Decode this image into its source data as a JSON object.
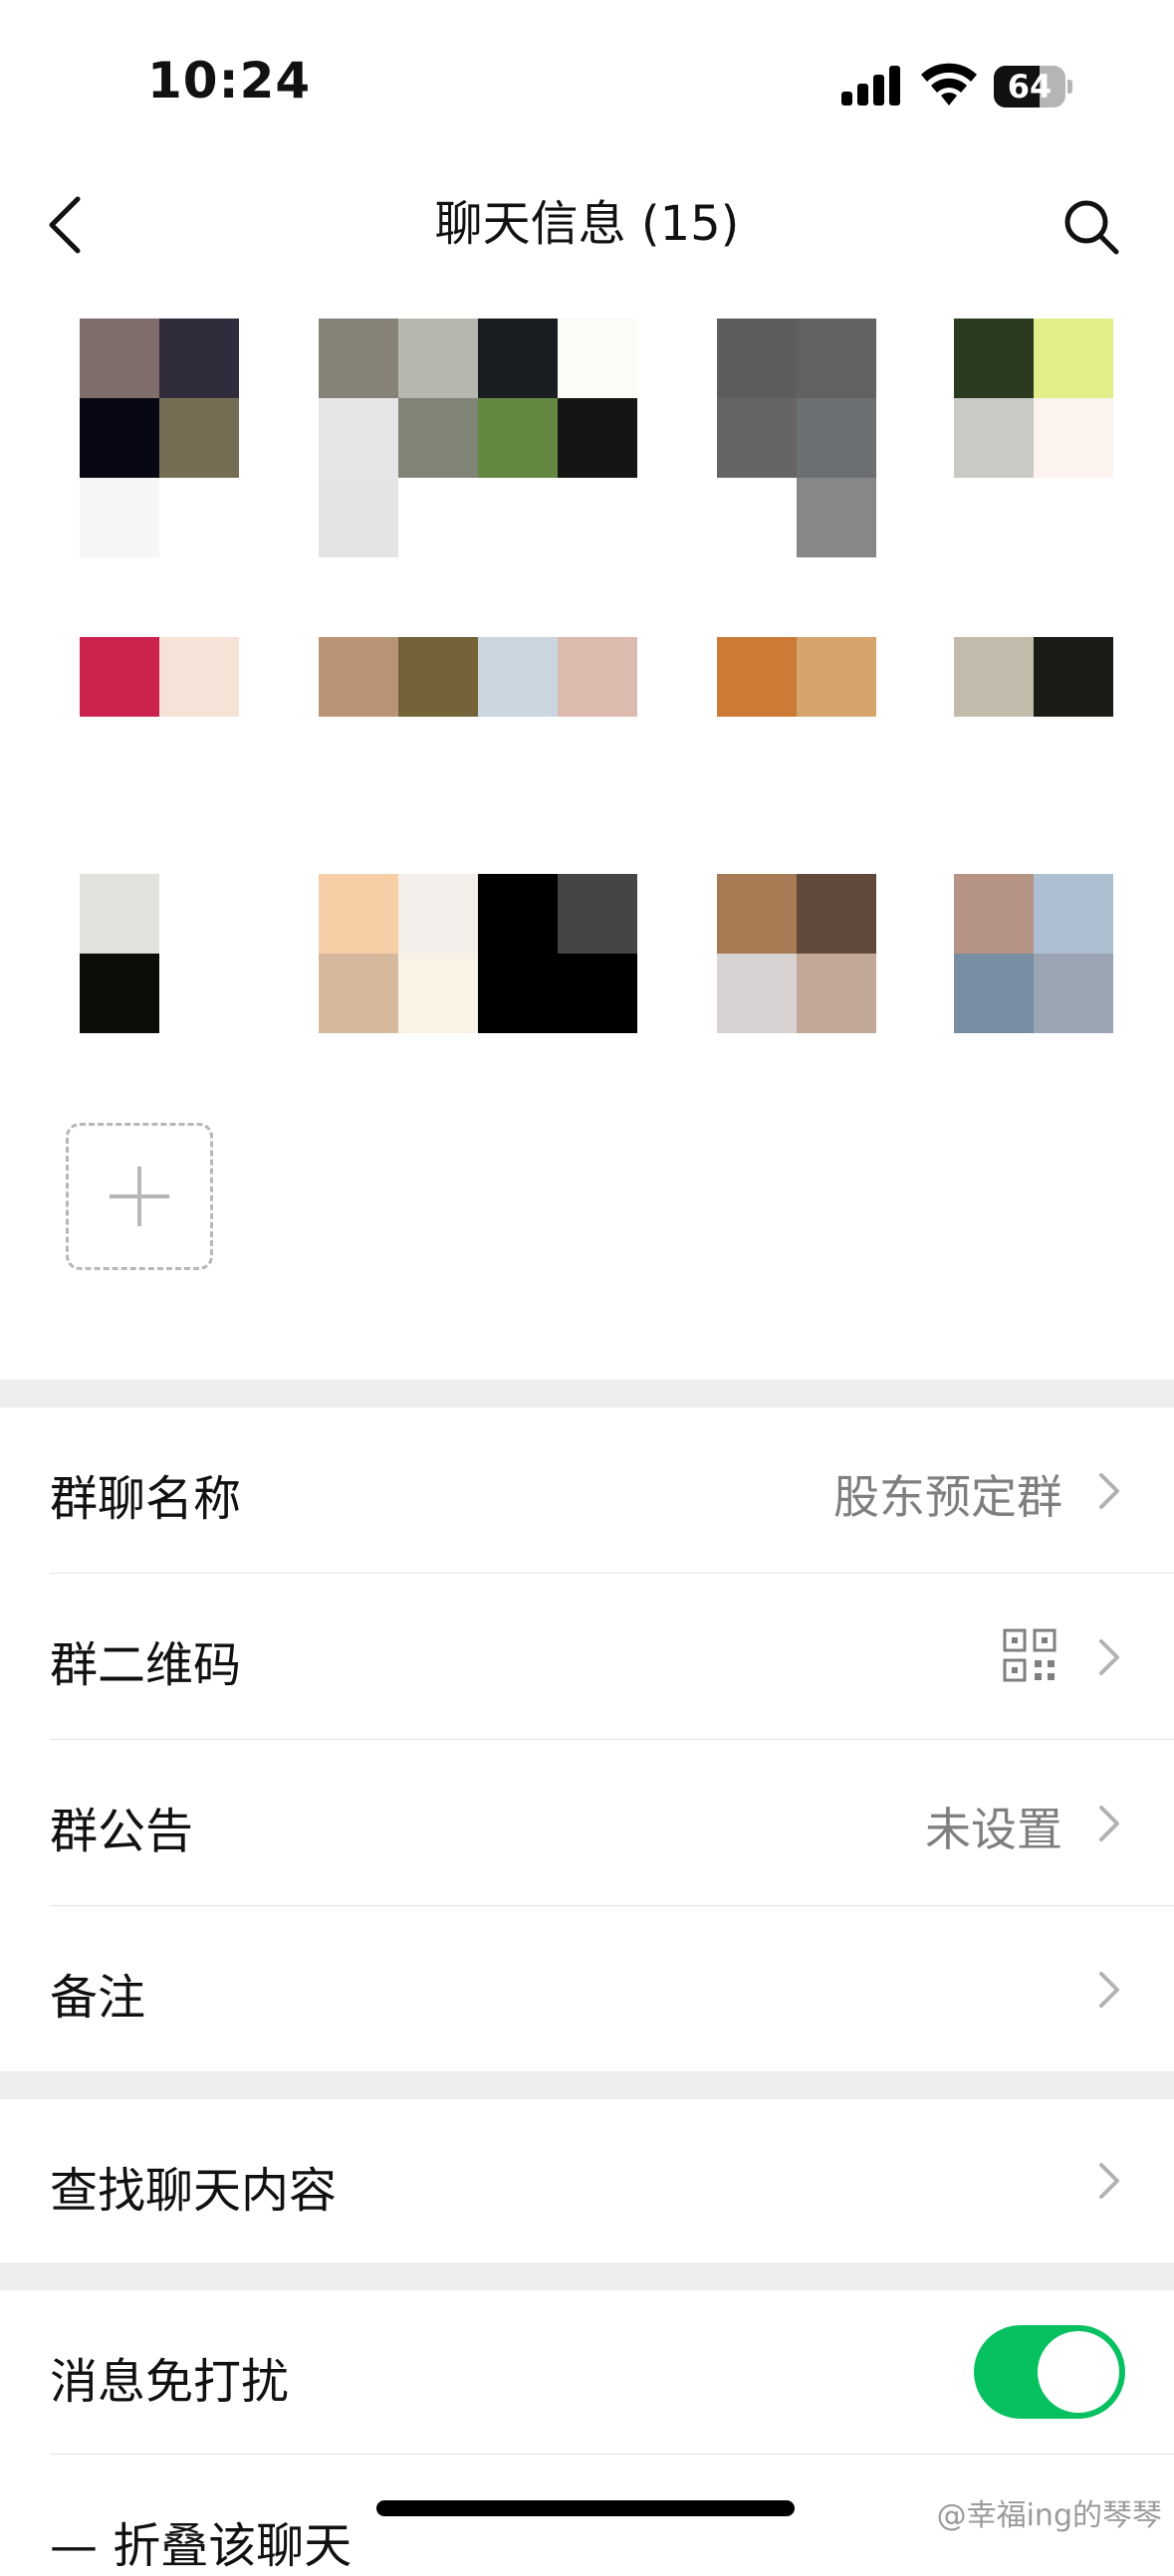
{
  "status_bar": {
    "time": "10:24",
    "battery": "64",
    "battery_level": 0.64
  },
  "nav": {
    "title": "聊天信息 (15)",
    "back_icon": "chevron-left-icon",
    "search_icon": "search-icon"
  },
  "members": [
    {
      "tiles": [
        "#7f6e69",
        "#302c3c",
        "#070814",
        "#756e55",
        "#f6f6f6",
        null
      ]
    },
    {
      "tiles": [
        "#868278",
        "#b6b8b0",
        "#1b1e21",
        "#fbfcf8",
        "#e4e6e7",
        "#7f8474",
        "#648842",
        "#131613",
        "#e4e4e4",
        null,
        null,
        null
      ]
    },
    {
      "tiles": [
        "#5d5d5d",
        "#626262",
        "#676465",
        "#6b6f72",
        null,
        "#878787"
      ]
    },
    {
      "tiles": [
        "#2b3b20",
        "#e1ee89",
        "#c9c9c5",
        "#fcf3ee"
      ]
    },
    {
      "tiles": [
        "#cc234c",
        "#f7e2d8"
      ]
    },
    {
      "tiles": [
        "#b89475",
        "#746238",
        "#c9d6e0",
        "#dcbbae"
      ]
    },
    {
      "tiles": [
        "#cb7b36",
        "#d6a46a"
      ]
    },
    {
      "tiles": [
        "#c1bbac",
        "#1b1c16"
      ]
    },
    {
      "tiles": [
        "#e4e2dc",
        null,
        "#0b0d09",
        null
      ]
    },
    {
      "tiles": [
        "#f7cda6",
        "#f3efea",
        "#000000",
        "#454545",
        "#d6b89d",
        "#f8f3e4",
        "#000000",
        "#000000"
      ]
    },
    {
      "tiles": [
        "#a77b54",
        "#614a3c",
        "#d8d2d3",
        "#c2a897"
      ]
    },
    {
      "tiles": [
        "#b59486",
        "#acc0d2",
        "#778da2",
        "#9aa4b3"
      ]
    }
  ],
  "add_member": {
    "icon": "plus-icon"
  },
  "settings": {
    "group_name": {
      "label": "群聊名称",
      "value": "股东预定群"
    },
    "group_qr": {
      "label": "群二维码",
      "icon": "qr-code-icon"
    },
    "announcement": {
      "label": "群公告",
      "value": "未设置"
    },
    "remark": {
      "label": "备注"
    },
    "search_chat": {
      "label": "查找聊天内容"
    },
    "mute": {
      "label": "消息免打扰",
      "enabled": true
    },
    "fold": {
      "label": "— 折叠该聊天"
    }
  },
  "watermark": "@幸福ing的琴琴",
  "colors": {
    "toggle_on": "#07c160",
    "separator_band": "#ededed"
  }
}
